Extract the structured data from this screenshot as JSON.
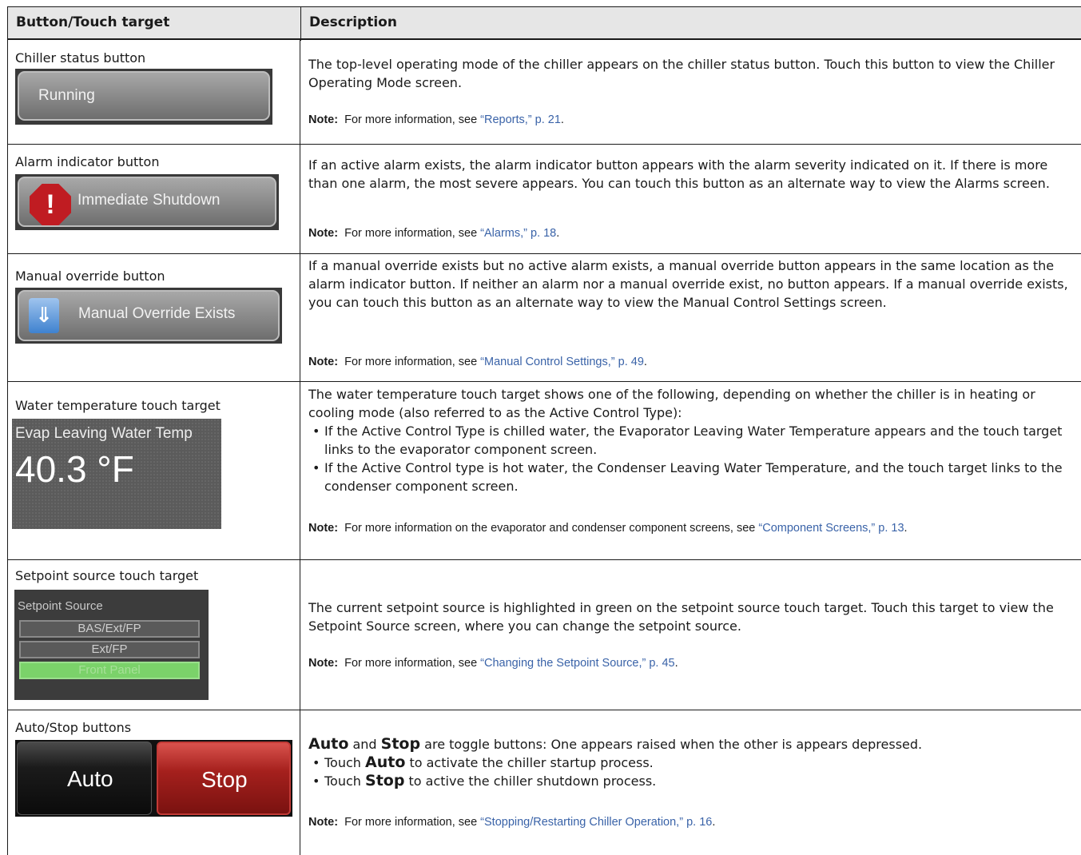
{
  "header": {
    "col1": "Button/Touch target",
    "col2": "Description"
  },
  "rows": [
    {
      "label": "Chiller status button",
      "widget": {
        "text": "Running"
      },
      "desc": "The top-level operating mode of the chiller appears on the chiller status button. Touch this button to view the Chiller Operating Mode screen.",
      "note_prefix": "Note:",
      "note_text": "For more information, see ",
      "note_link": "“Reports,” p. 21",
      "note_end": "."
    },
    {
      "label": "Alarm indicator button",
      "widget": {
        "text": "Immediate Shutdown",
        "icon": "!"
      },
      "desc": "If an active alarm exists, the alarm indicator button appears with the alarm severity indicated on it. If there is more than one alarm, the most severe appears. You can touch this button as an alternate way to view the Alarms screen.",
      "note_prefix": "Note:",
      "note_text": "For more information, see ",
      "note_link": "“Alarms,” p. 18",
      "note_end": "."
    },
    {
      "label": "Manual override button",
      "widget": {
        "text": "Manual Override Exists"
      },
      "desc": "If a manual override exists but no active alarm exists, a manual override button appears in the same location as the alarm indicator button. If neither an alarm nor a manual override exist, no button appears. If a manual override exists, you can touch this button as an alternate way to view the Manual Control Settings screen.",
      "note_prefix": "Note:",
      "note_text": "For more information, see ",
      "note_link": "“Manual Control Settings,” p. 49",
      "note_end": "."
    },
    {
      "label": "Water temperature touch target",
      "widget": {
        "title": "Evap Leaving Water Temp",
        "value": "40.3 °F"
      },
      "desc": "The water temperature touch target shows one of the following, depending on whether the chiller is in heating or cooling mode (also referred to as the Active Control Type):",
      "bullets": [
        "If the Active Control Type is chilled water, the Evaporator Leaving Water Temperature appears and the touch target links to the evaporator component screen.",
        "If the Active Control type is hot water, the Condenser Leaving Water Temperature, and the touch target links to the condenser component screen."
      ],
      "note_prefix": "Note:",
      "note_text": "For more information on the evaporator and condenser component screens, see ",
      "note_link": "“Component Screens,” p. 13",
      "note_end": "."
    },
    {
      "label": "Setpoint source touch target",
      "widget": {
        "title": "Setpoint Source",
        "options": [
          "BAS/Ext/FP",
          "Ext/FP",
          "Front Panel"
        ]
      },
      "desc": "The current setpoint source is highlighted in green on the setpoint source touch target. Touch this target to view the Setpoint Source screen, where you can change the setpoint source.",
      "note_prefix": "Note:",
      "note_text": "For more information, see ",
      "note_link": "“Changing the Setpoint Source,” p. 45",
      "note_end": "."
    },
    {
      "label": "Auto/Stop buttons",
      "widget": {
        "auto": "Auto",
        "stop": "Stop"
      },
      "desc_auto": "Auto",
      "desc_and": " and ",
      "desc_stop": "Stop",
      "desc_rest": " are toggle buttons: One appears raised when the other is appears depressed.",
      "bullet1_pre": "Touch ",
      "bullet1_bold": "Auto",
      "bullet1_post": " to activate the chiller startup process.",
      "bullet2_pre": "Touch ",
      "bullet2_bold": "Stop",
      "bullet2_post": " to active the chiller shutdown process.",
      "note_prefix": "Note:",
      "note_text": "For more information, see ",
      "note_link": "“Stopping/Restarting Chiller Operation,” p. 16",
      "note_end": "."
    }
  ]
}
